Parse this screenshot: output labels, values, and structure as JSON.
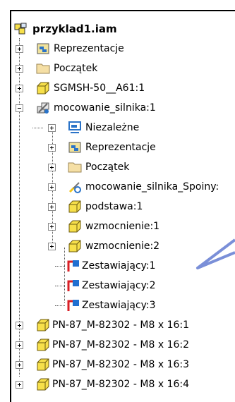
{
  "tree": {
    "root": {
      "label": "przyklad1.iam",
      "icon": "assembly-icon"
    },
    "items": [
      {
        "label": "Reprezentacje",
        "icon": "representations-icon"
      },
      {
        "label": "Początek",
        "icon": "folder-icon"
      },
      {
        "label": "SGMSH-50__A61:1",
        "icon": "part-icon"
      },
      {
        "label": "mocowanie_silnika:1",
        "icon": "weldment-assembly-icon"
      },
      {
        "label": "Niezależne",
        "icon": "independent-icon"
      },
      {
        "label": "Reprezentacje",
        "icon": "representations-icon"
      },
      {
        "label": "Początek",
        "icon": "folder-icon"
      },
      {
        "label": "mocowanie_silnika_Spoiny:",
        "icon": "welds-icon"
      },
      {
        "label": "podstawa:1",
        "icon": "part-icon"
      },
      {
        "label": "wzmocnienie:1",
        "icon": "part-icon"
      },
      {
        "label": "wzmocnienie:2",
        "icon": "part-icon"
      },
      {
        "label": "Zestawiający:1",
        "icon": "constraint-icon"
      },
      {
        "label": "Zestawiający:2",
        "icon": "constraint-icon"
      },
      {
        "label": "Zestawiający:3",
        "icon": "constraint-icon"
      },
      {
        "label": "PN-87_M-82302 - M8 x 16:1",
        "icon": "part-icon"
      },
      {
        "label": "PN-87_M-82302 - M8 x 16:2",
        "icon": "part-icon"
      },
      {
        "label": "PN-87_M-82302 - M8 x 16:3",
        "icon": "part-icon"
      },
      {
        "label": "PN-87_M-82302 - M8 x 16:4",
        "icon": "part-icon"
      }
    ]
  },
  "colors": {
    "part_yellow": "#f7e04a",
    "constraint_red": "#d91f26",
    "constraint_blue": "#1f6fd1",
    "callout_blue": "#7a8fd8"
  }
}
